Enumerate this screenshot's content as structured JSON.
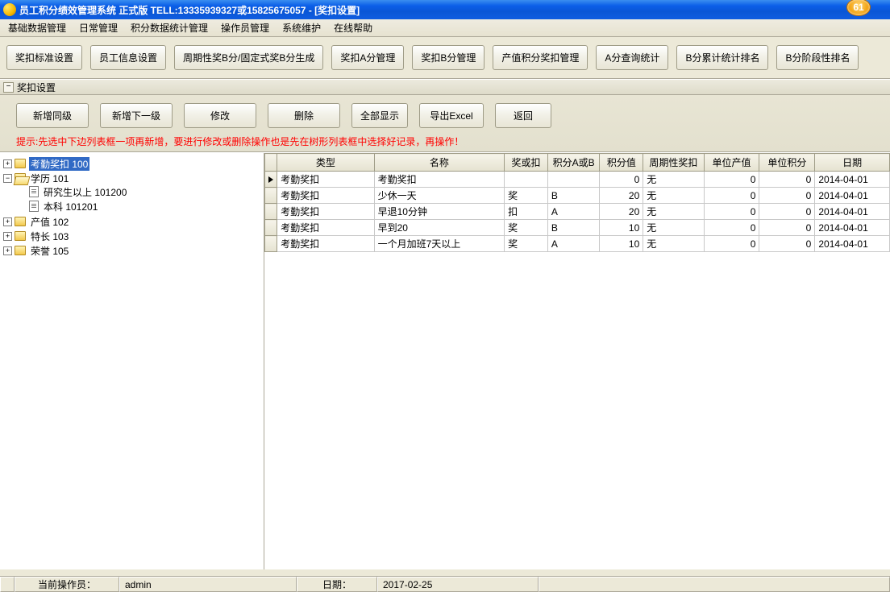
{
  "window": {
    "title": "员工积分绩效管理系统 正式版 TELL:13335939327或15825675057 - [奖扣设置]",
    "badge": "61"
  },
  "menu": {
    "items": [
      "基础数据管理",
      "日常管理",
      "积分数据统计管理",
      "操作员管理",
      "系统维护",
      "在线帮助"
    ]
  },
  "toolbar_top": {
    "b1": "奖扣标准设置",
    "b2": "员工信息设置",
    "b3": "周期性奖B分/固定式奖B分生成",
    "b4": "奖扣A分管理",
    "b5": "奖扣B分管理",
    "b6": "产值积分奖扣管理",
    "b7": "A分查询统计",
    "b8": "B分累计统计排名",
    "b9": "B分阶段性排名"
  },
  "section": {
    "title": "奖扣设置"
  },
  "toolbar_panel": {
    "add_sibling": "新增同级",
    "add_child": "新增下一级",
    "modify": "修改",
    "delete": "删除",
    "show_all": "全部显示",
    "export": "导出Excel",
    "back": "返回"
  },
  "hint": "提示:先选中下边列表框一项再新增，要进行修改或删除操作也是先在树形列表框中选择好记录，再操作！",
  "tree": {
    "n1": "考勤奖扣 100",
    "n2": "学历 101",
    "n2a": "研究生以上 101200",
    "n2b": "本科 101201",
    "n3": "产值 102",
    "n4": "特长 103",
    "n5": "荣誉 105"
  },
  "grid": {
    "headers": {
      "type": "类型",
      "name": "名称",
      "reward": "奖或扣",
      "ab": "积分A或B",
      "points": "积分值",
      "periodic": "周期性奖扣",
      "unit_value": "单位产值",
      "unit_points": "单位积分",
      "date": "日期"
    },
    "rows": [
      {
        "type": "考勤奖扣",
        "name": "考勤奖扣",
        "reward": "",
        "ab": "",
        "points": "0",
        "periodic": "无",
        "unit_value": "0",
        "unit_points": "0",
        "date": "2014-04-01"
      },
      {
        "type": "考勤奖扣",
        "name": "少休一天",
        "reward": "奖",
        "ab": "B",
        "points": "20",
        "periodic": "无",
        "unit_value": "0",
        "unit_points": "0",
        "date": "2014-04-01"
      },
      {
        "type": "考勤奖扣",
        "name": "早退10分钟",
        "reward": "扣",
        "ab": "A",
        "points": "20",
        "periodic": "无",
        "unit_value": "0",
        "unit_points": "0",
        "date": "2014-04-01"
      },
      {
        "type": "考勤奖扣",
        "name": "早到20",
        "reward": "奖",
        "ab": "B",
        "points": "10",
        "periodic": "无",
        "unit_value": "0",
        "unit_points": "0",
        "date": "2014-04-01"
      },
      {
        "type": "考勤奖扣",
        "name": "一个月加班7天以上",
        "reward": "奖",
        "ab": "A",
        "points": "10",
        "periodic": "无",
        "unit_value": "0",
        "unit_points": "0",
        "date": "2014-04-01"
      }
    ]
  },
  "status": {
    "operator_label": "当前操作员：",
    "operator_value": "admin",
    "date_label": "日期：",
    "date_value": "2017-02-25"
  }
}
